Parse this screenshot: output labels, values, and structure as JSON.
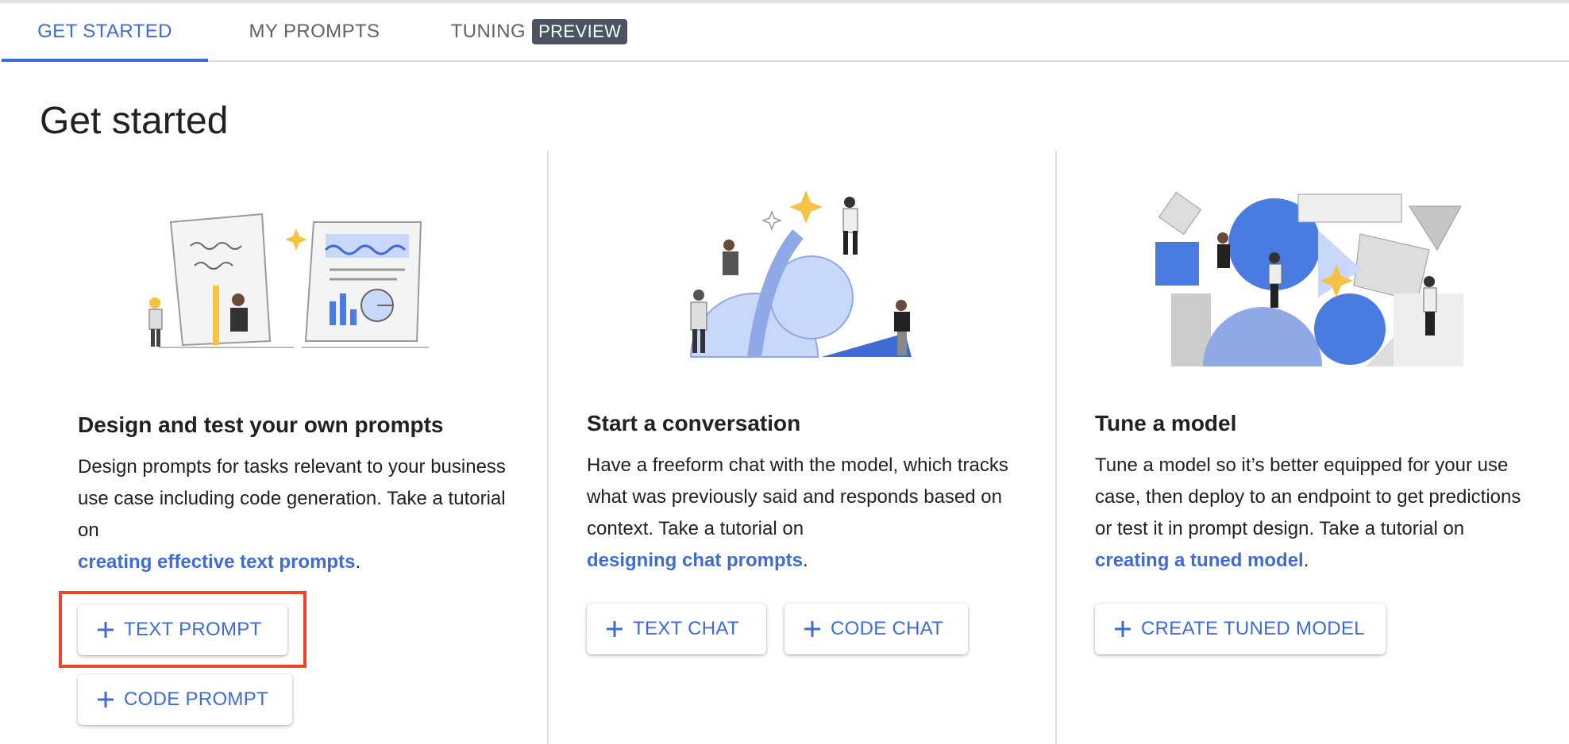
{
  "tabs": [
    {
      "label": "GET STARTED",
      "active": true
    },
    {
      "label": "MY PROMPTS",
      "active": false
    },
    {
      "label": "TUNING",
      "badge": "PREVIEW",
      "active": false
    }
  ],
  "page_title": "Get started",
  "cards": [
    {
      "title": "Design and test your own prompts",
      "desc": "Design prompts for tasks relevant to your business use case including code generation. Take a tutorial on",
      "link": "creating effective text prompts",
      "suffix": ".",
      "buttons": [
        {
          "label": "TEXT PROMPT",
          "icon": "plus-icon",
          "highlighted": true
        },
        {
          "label": "CODE PROMPT",
          "icon": "plus-icon"
        }
      ]
    },
    {
      "title": "Start a conversation",
      "desc": "Have a freeform chat with the model, which tracks what was previously said and responds based on context. Take a tutorial on",
      "link": "designing chat prompts",
      "suffix": ".",
      "buttons": [
        {
          "label": "TEXT CHAT",
          "icon": "plus-icon"
        },
        {
          "label": "CODE CHAT",
          "icon": "plus-icon"
        }
      ]
    },
    {
      "title": "Tune a model",
      "desc": "Tune a model so it’s better equipped for your use case, then deploy to an endpoint to get predictions or test it in prompt design. Take a tutorial on",
      "link": "creating a tuned model",
      "suffix": ".",
      "buttons": [
        {
          "label": "CREATE TUNED MODEL",
          "icon": "plus-icon"
        }
      ]
    }
  ],
  "colors": {
    "accent": "#3f6bd4",
    "highlight": "#e8472c",
    "badge": "#4a5561",
    "star": "#f6c244",
    "illustration_blue": "#c9d8fa"
  }
}
